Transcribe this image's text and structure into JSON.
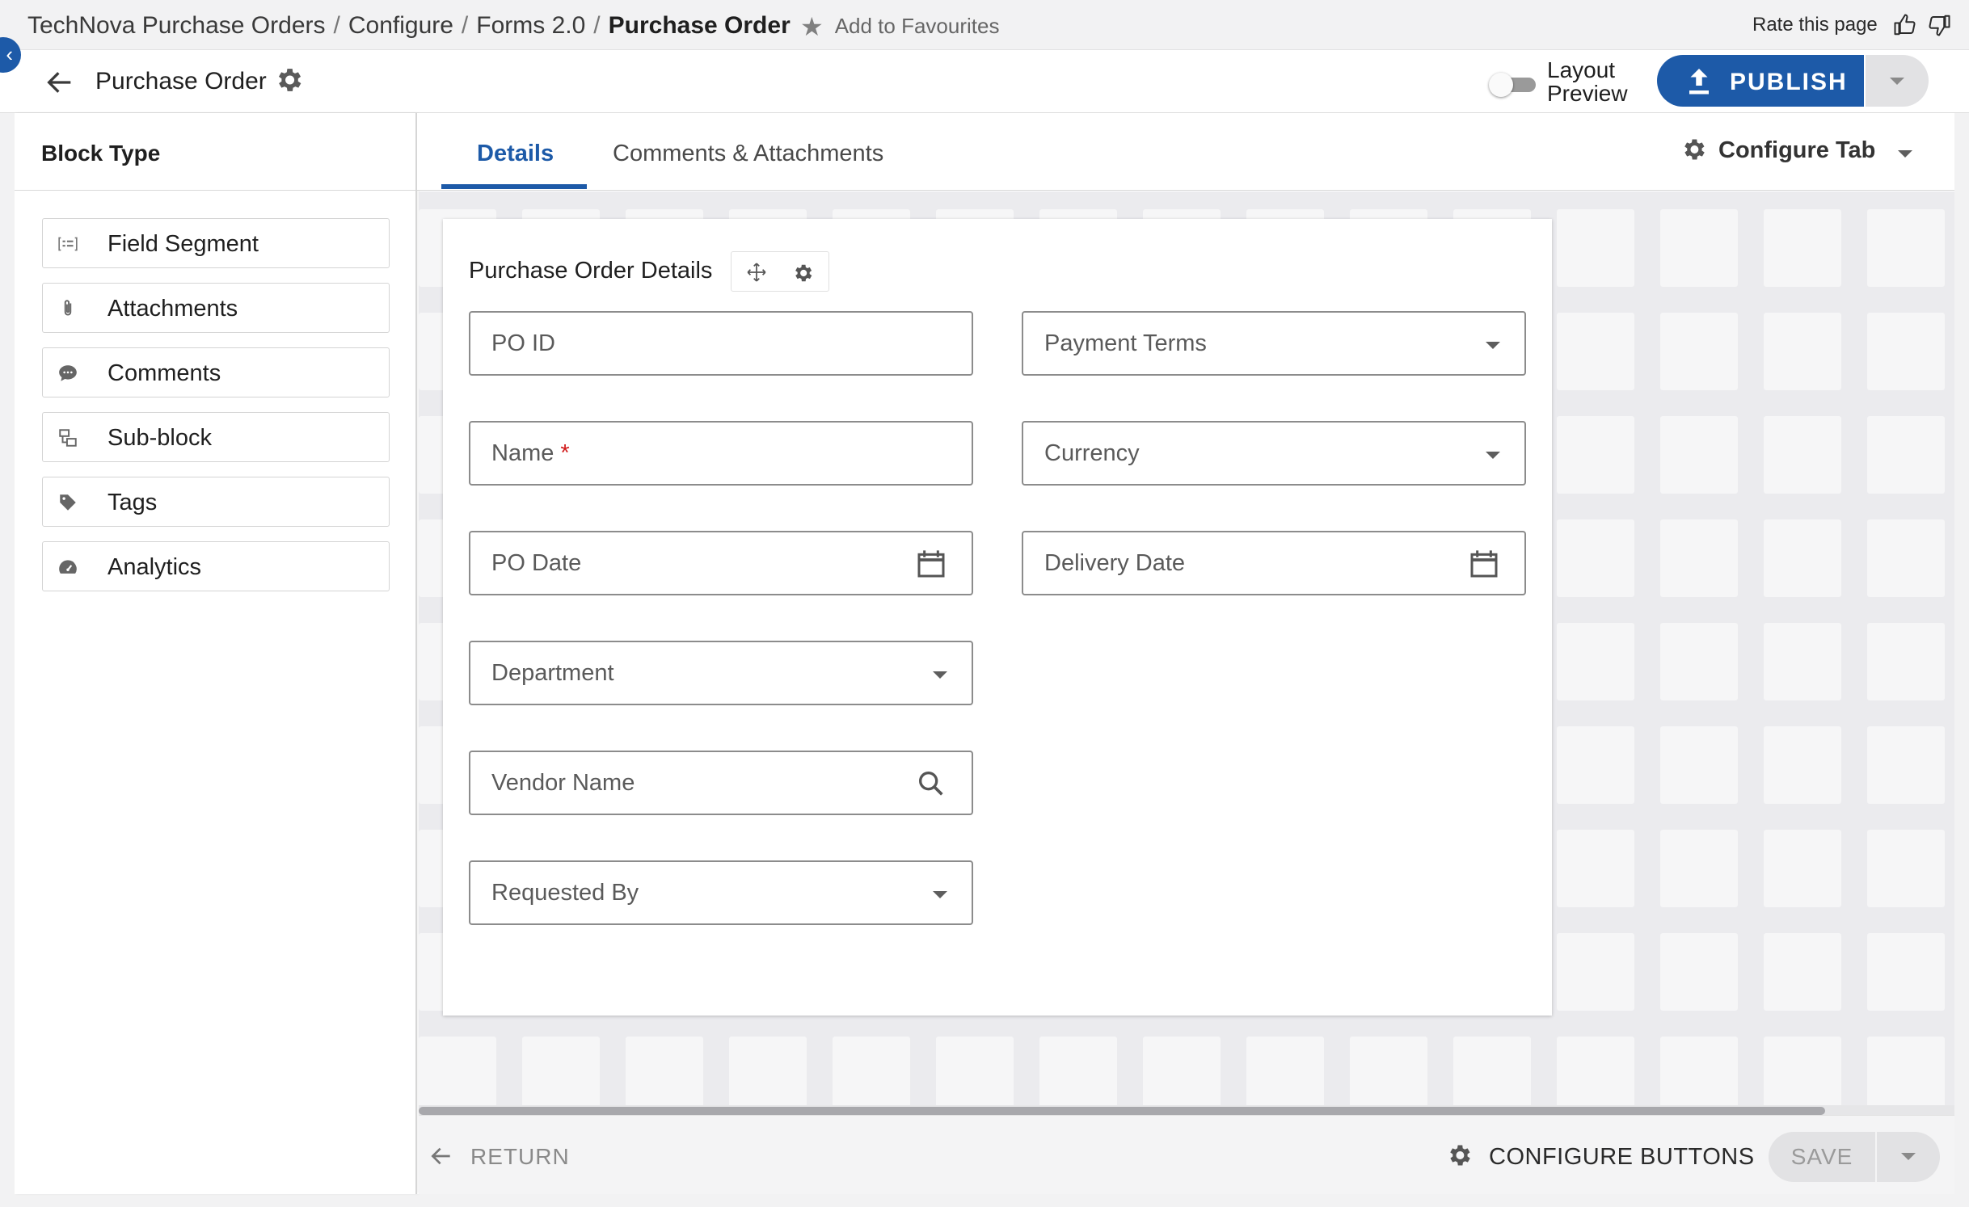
{
  "breadcrumb": {
    "items": [
      "TechNova Purchase Orders",
      "Configure",
      "Forms 2.0"
    ],
    "current": "Purchase Order",
    "separator": "/"
  },
  "favourites": {
    "label": "Add to Favourites",
    "icon": "star-icon"
  },
  "rating": {
    "label": "Rate this page",
    "icons": [
      "thumbs-up-icon",
      "thumbs-down-icon"
    ]
  },
  "header": {
    "title": "Purchase Order",
    "layout_preview_label": "Layout\nPreview",
    "layout_preview_on": false,
    "publish_label": "PUBLISH"
  },
  "block_panel": {
    "title": "Block Type",
    "items": [
      {
        "label": "Field Segment",
        "icon": "field-segment-icon"
      },
      {
        "label": "Attachments",
        "icon": "paperclip-icon"
      },
      {
        "label": "Comments",
        "icon": "comment-icon"
      },
      {
        "label": "Sub-block",
        "icon": "sub-block-icon"
      },
      {
        "label": "Tags",
        "icon": "tag-icon"
      },
      {
        "label": "Analytics",
        "icon": "gauge-icon"
      }
    ]
  },
  "tabs": {
    "items": [
      {
        "label": "Details",
        "active": true
      },
      {
        "label": "Comments & Attachments",
        "active": false
      }
    ],
    "configure_label": "Configure Tab"
  },
  "form": {
    "section_title": "Purchase Order Details",
    "fields_left": [
      {
        "label": "PO ID",
        "type": "text"
      },
      {
        "label": "Name",
        "type": "text",
        "required": "*"
      },
      {
        "label": "PO Date",
        "type": "date"
      },
      {
        "label": "Department",
        "type": "select"
      },
      {
        "label": "Vendor Name",
        "type": "lookup"
      },
      {
        "label": "Requested By",
        "type": "select"
      }
    ],
    "fields_right": [
      {
        "label": "Payment Terms",
        "type": "select"
      },
      {
        "label": "Currency",
        "type": "select"
      },
      {
        "label": "Delivery Date",
        "type": "date"
      }
    ]
  },
  "footer": {
    "return_label": "RETURN",
    "configure_buttons_label": "CONFIGURE BUTTONS",
    "save_label": "SAVE"
  },
  "colors": {
    "accent": "#1d5aa8",
    "required": "#d11a1a",
    "canvas": "#ebebee"
  }
}
